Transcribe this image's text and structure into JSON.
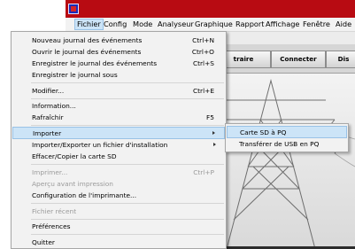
{
  "menubar": {
    "items": [
      "Fichier",
      "Config",
      "Mode",
      "Analyseur",
      "Graphique",
      "Rapport",
      "Affichage",
      "Fenêtre",
      "Aide"
    ]
  },
  "toolbar": {
    "buttons": [
      "traire",
      "Connecter",
      "Dis"
    ]
  },
  "file_menu": {
    "items": [
      {
        "label": "Nouveau journal des événements",
        "shortcut": "Ctrl+N"
      },
      {
        "label": "Ouvrir le journal des événements",
        "shortcut": "Ctrl+O"
      },
      {
        "label": "Enregistrer le journal des événements",
        "shortcut": "Ctrl+S"
      },
      {
        "label": "Enregistrer le journal sous",
        "shortcut": ""
      },
      {
        "label": "Modifier...",
        "shortcut": "Ctrl+E"
      },
      {
        "label": "Information...",
        "shortcut": ""
      },
      {
        "label": "Rafraîchir",
        "shortcut": "F5"
      },
      {
        "label": "Importer",
        "shortcut": ""
      },
      {
        "label": "Importer/Exporter un fichier d'installation",
        "shortcut": ""
      },
      {
        "label": "Effacer/Copier la carte SD",
        "shortcut": ""
      },
      {
        "label": "Imprimer...",
        "shortcut": "Ctrl+P"
      },
      {
        "label": "Aperçu avant impression",
        "shortcut": ""
      },
      {
        "label": "Configuration de l'imprimante...",
        "shortcut": ""
      },
      {
        "label": "Fichier récent",
        "shortcut": ""
      },
      {
        "label": "Préférences",
        "shortcut": ""
      },
      {
        "label": "Quitter",
        "shortcut": ""
      }
    ]
  },
  "import_submenu": {
    "items": [
      "Carte SD à PQ",
      "Transférer de USB en PQ"
    ]
  },
  "colors": {
    "titlebar": "#b80b12",
    "highlight": "#cce4f7",
    "menu_bg": "#f2f2f2",
    "disabled_text": "#9a9a9a"
  },
  "icons": [
    "app-icon",
    "submenu-arrow-icon"
  ]
}
